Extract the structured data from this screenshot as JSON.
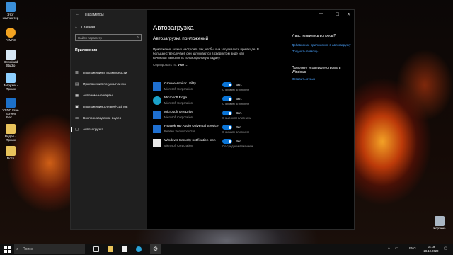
{
  "desktop": {
    "icons": [
      {
        "label": "Этот компьютер",
        "color": "#3b8fd9"
      },
      {
        "label": "AIMP3",
        "color": "#f2a321"
      },
      {
        "label": "Download Studio",
        "color": "#d8e8f5"
      },
      {
        "label": "Загрузки - Ярлык",
        "color": "#8fd0ff"
      },
      {
        "label": "VSDC Free Screen Rec...",
        "color": "#1c70c9"
      },
      {
        "label": "Видео - Ярлык",
        "color": "#e9c35b"
      },
      {
        "label": "Docx",
        "color": "#e9c35b"
      }
    ],
    "recycle_bin": {
      "label": "Корзина",
      "color": "#aab7c4"
    }
  },
  "window": {
    "title": "Параметры",
    "back_icon": "back-arrow-icon",
    "controls": [
      "minimize",
      "maximize",
      "close"
    ]
  },
  "sidebar": {
    "home": "Главная",
    "search_placeholder": "Найти параметр",
    "section": "Приложения",
    "items": [
      {
        "label": "Приложения и возможности",
        "icon": "list-icon"
      },
      {
        "label": "Приложения по умолчанию",
        "icon": "default-apps-icon"
      },
      {
        "label": "Автономные карты",
        "icon": "map-icon"
      },
      {
        "label": "Приложения для веб-сайтов",
        "icon": "web-apps-icon"
      },
      {
        "label": "Воспроизведение видео",
        "icon": "video-icon"
      },
      {
        "label": "Автозагрузка",
        "icon": "startup-icon",
        "active": true
      }
    ]
  },
  "main": {
    "title": "Автозагрузка",
    "section_title": "Автозагрузка приложений",
    "description": "Приложения можно настроить так, чтобы они запускались при входе. В большинстве случаев они запускаются в свернутом виде или начинают выполнять только фоновую задачу.",
    "sort_label": "Сортировать по:",
    "sort_value": "Имя",
    "apps": [
      {
        "name": "GrooveMonitor Utility",
        "publisher": "Microsoft Corporation",
        "state": "Вкл.",
        "impact": "С низким влиянием",
        "icon_color": "#1e6fd0"
      },
      {
        "name": "Microsoft Edge",
        "publisher": "Microsoft Corporation",
        "state": "Вкл.",
        "impact": "С низким влиянием",
        "icon_color": "#1aa1c9"
      },
      {
        "name": "Microsoft OneDrive",
        "publisher": "Microsoft Corporation",
        "state": "Вкл.",
        "impact": "С высоким влиянием",
        "icon_color": "#1e6fd0"
      },
      {
        "name": "Realtek HD Audio Universal Service",
        "publisher": "Realtek Semiconductor",
        "state": "Вкл.",
        "impact": "С низким влиянием",
        "icon_color": "#1e6fd0"
      },
      {
        "name": "Windows Security notification icon",
        "publisher": "Microsoft Corporation",
        "state": "Вкл.",
        "impact": "Со средним влиянием",
        "icon_color": "#e8e8e8"
      }
    ]
  },
  "aside": {
    "question": "У вас появились вопросы?",
    "links1": [
      "Добавление приложения в автозагрузку",
      "Получить помощь"
    ],
    "improve": "Помогите усовершенствовать Windows",
    "links2": [
      "Оставить отзыв"
    ]
  },
  "taskbar": {
    "search_placeholder": "Поиск",
    "apps": [
      {
        "name": "task-view",
        "color": "#dddddd"
      },
      {
        "name": "explorer",
        "color": "#e9c35b"
      },
      {
        "name": "mail",
        "color": "#eeeeee"
      },
      {
        "name": "edge",
        "color": "#2aa4d9"
      },
      {
        "name": "chrome",
        "color": "#e14c3d"
      },
      {
        "name": "settings",
        "color": "#dddddd",
        "active": true
      }
    ],
    "language": "ENG",
    "time": "15:19",
    "date": "28.10.2020"
  }
}
